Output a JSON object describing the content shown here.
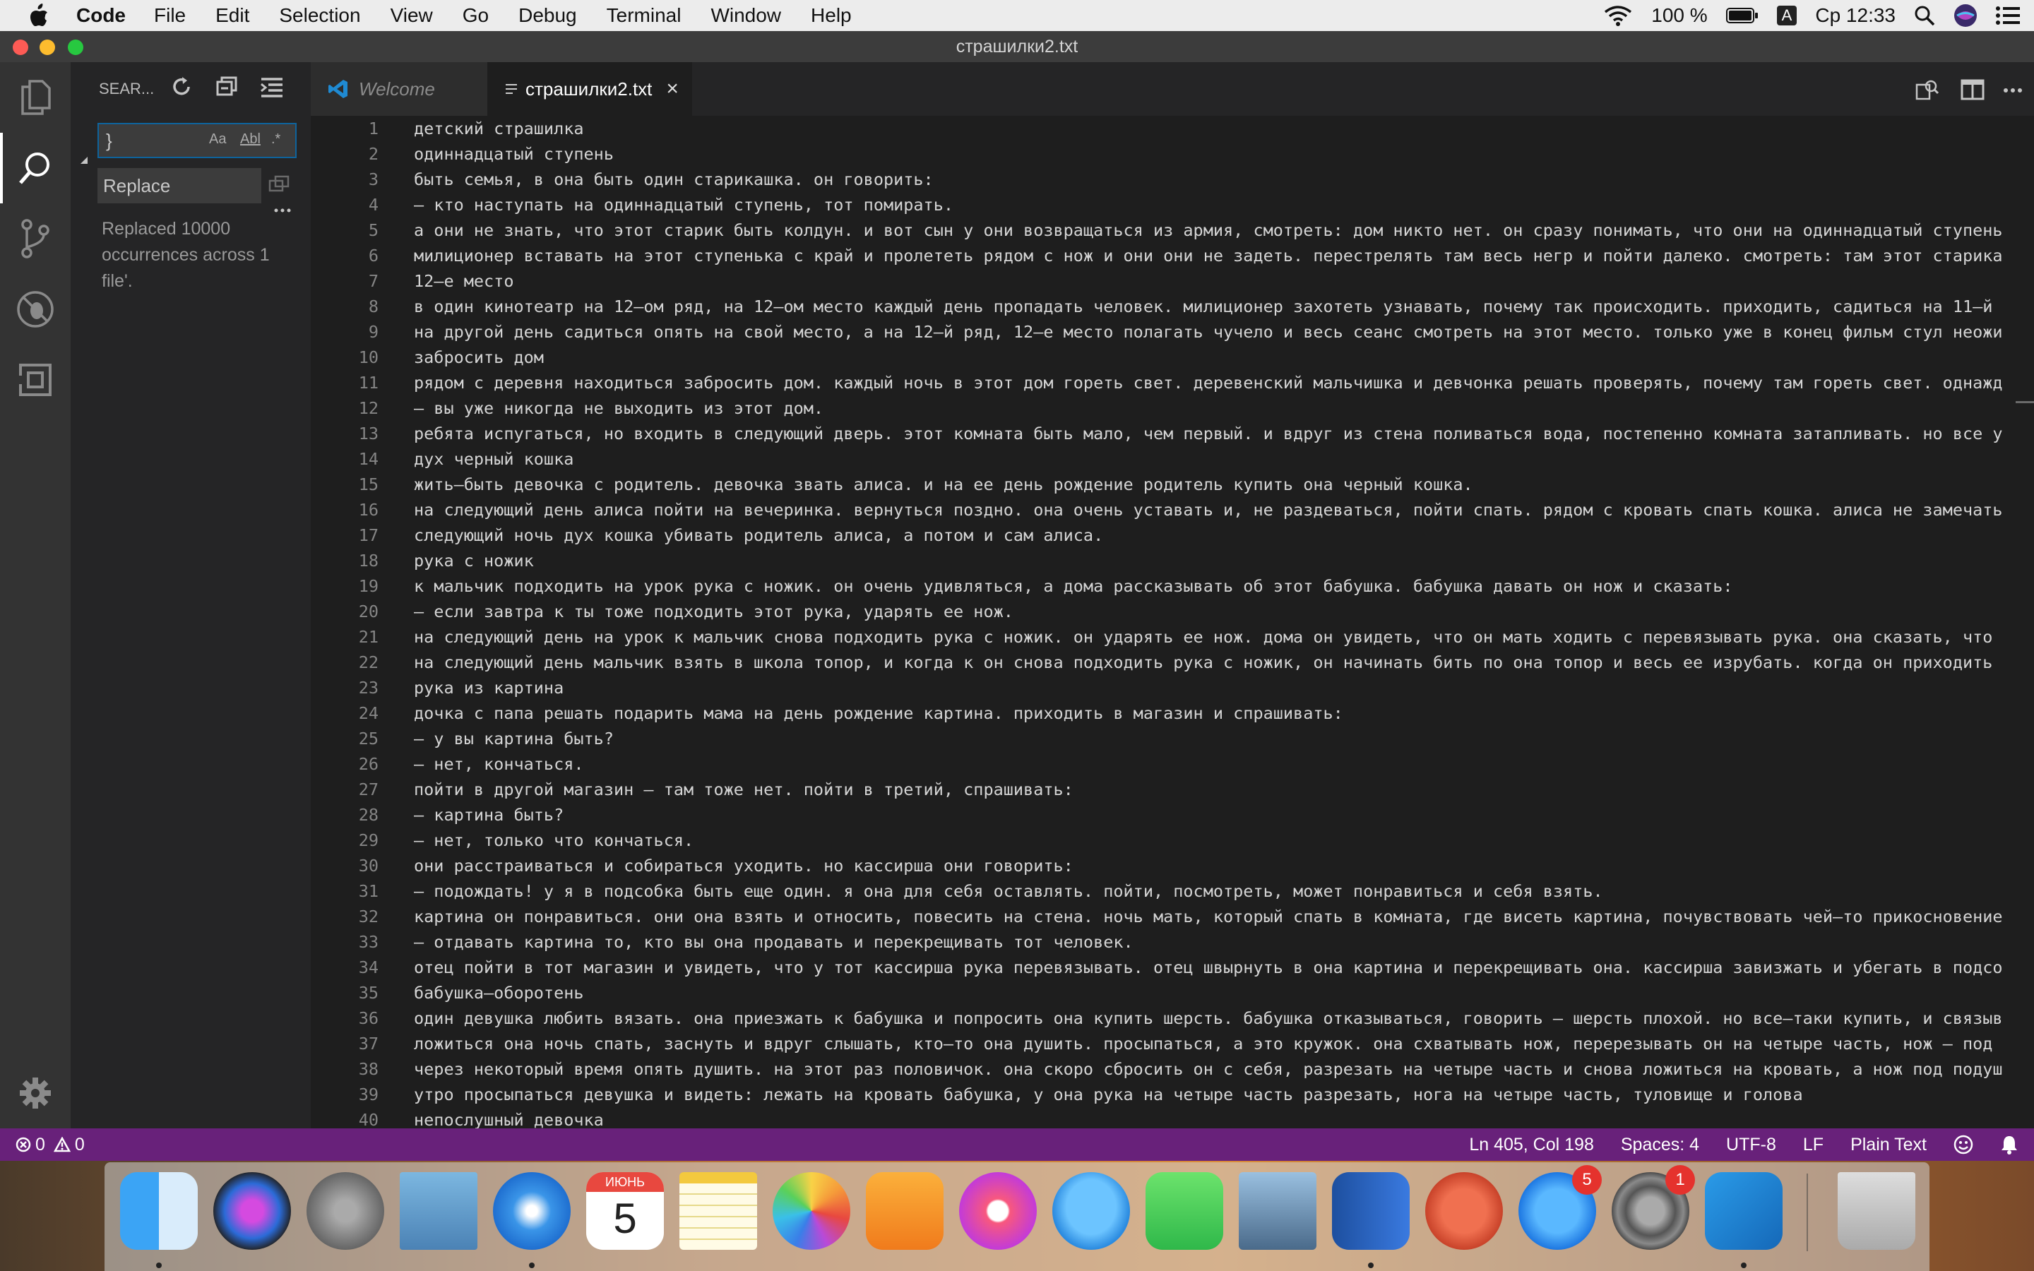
{
  "menubar": {
    "app": "Code",
    "items": [
      "File",
      "Edit",
      "Selection",
      "View",
      "Go",
      "Debug",
      "Terminal",
      "Window",
      "Help"
    ],
    "battery": "100 %",
    "input_source": "A",
    "clock": "Ср 12:33"
  },
  "window": {
    "title": "страшилки2.txt"
  },
  "sidebar": {
    "header": "SEAR...",
    "search_value": "}",
    "search_opts": [
      "Aa",
      "Abl",
      ".*"
    ],
    "replace_placeholder": "Replace",
    "result_message": "Replaced 10000 occurrences across 1 file'."
  },
  "tabs": [
    {
      "label": "Welcome",
      "active": false
    },
    {
      "label": "страшилки2.txt",
      "active": true,
      "close": "×"
    }
  ],
  "editor": {
    "lines": [
      "детский страшилка",
      "одиннадцатый ступень",
      "быть семья, в она быть один старикашка. он говорить:",
      "— кто наступать на одиннадцатый ступень, тот помирать.",
      "а они не знать, что этот старик быть колдун. и вот сын у они возвращаться из армия, смотреть: дом никто нет. он сразу понимать, что они на одиннадцатый ступень",
      "милиционер вставать на этот ступенька с край и пролететь рядом с нож и они они не задеть. перестрелять там весь негр и пойти далеко. смотреть: там этот старика",
      "12–е место",
      "в один кинотеатр на 12–ом ряд, на 12–ом место каждый день пропадать человек. милиционер захотеть узнавать, почему так происходить. приходить, садиться на 11–й",
      "на другой день садиться опять на свой место, а на 12–й ряд, 12–е место полагать чучело и весь сеанс смотреть на этот место. только уже в конец фильм стул неожи",
      "забросить дом",
      "рядом с деревня находиться забросить дом. каждый ночь в этот дом гореть свет. деревенский мальчишка и девчонка решать проверять, почему там гореть свет. однажд",
      "— вы уже никогда не выходить из этот дом.",
      "ребята испугаться, но входить в следующий дверь. этот комната быть мало, чем первый. и вдруг из стена поливаться вода, постепенно комната затапливать. но все у",
      "дух черный кошка",
      "жить–быть девочка с родитель. девочка звать алиса. и на ее день рождение родитель купить она черный кошка.",
      "на следующий день алиса пойти на вечеринка. вернуться поздно. она очень уставать и, не раздеваться, пойти спать. рядом с кровать спать кошка. алиса не замечать",
      "следующий ночь дух кошка убивать родитель алиса, а потом и сам алиса.",
      "рука с ножик",
      "к мальчик подходить на урок рука с ножик. он очень удивляться, а дома рассказывать об этот бабушка. бабушка давать он нож и сказать:",
      "— если завтра к ты тоже подходить этот рука, ударять ее нож.",
      "на следующий день на урок к мальчик снова подходить рука с ножик. он ударять ее нож. дома он увидеть, что он мать ходить с перевязывать рука. она сказать, что",
      "на следующий день мальчик взять в школа топор, и когда к он снова подходить рука с ножик, он начинать бить по она топор и весь ее изрубать. когда он приходить",
      "рука из картина",
      "дочка с папа решать подарить мама на день рождение картина. приходить в магазин и спрашивать:",
      "— у вы картина быть?",
      "— нет, кончаться.",
      "пойти в другой магазин — там тоже нет. пойти в третий, спрашивать:",
      "— картина быть?",
      "— нет, только что кончаться.",
      "они расстраиваться и собираться уходить. но кассирша они говорить:",
      "— подождать! у я в подсобка быть еще один. я она для себя оставлять. пойти, посмотреть, может понравиться и себя взять.",
      "картина он понравиться. они она взять и относить, повесить на стена. ночь мать, который спать в комната, где висеть картина, почувствовать чей–то прикосновение",
      "— отдавать картина то, кто вы она продавать и перекрещивать тот человек.",
      "отец пойти в тот магазин и увидеть, что у тот кассирша рука перевязывать. отец швырнуть в она картина и перекрещивать она. кассирша завизжать и убегать в подсо",
      "бабушка–оборотень",
      "один девушка любить вязать. она приезжать к бабушка и попросить она купить шерсть. бабушка отказываться, говорить — шерсть плохой. но все–таки купить, и связыв",
      "ложиться она ночь спать, заснуть и вдруг слышать, кто–то она душить. просыпаться, а это кружок. она схватывать нож, перерезывать он на четыре часть, нож — под",
      "через некоторый время опять душить. на этот раз половичок. она скоро сбросить он с себя, разрезать на четыре часть и снова ложиться на кровать, а нож под подуш",
      "утро просыпаться девушка и видеть: лежать на кровать бабушка, у она рука на четыре часть разрезать, нога на четыре часть, туловище и голова",
      "непослушный девочка"
    ]
  },
  "statusbar": {
    "errors": "0",
    "warnings": "0",
    "position": "Ln 405, Col 198",
    "spaces": "Spaces: 4",
    "encoding": "UTF-8",
    "eol": "LF",
    "language": "Plain Text"
  },
  "dock": {
    "calendar_month": "ИЮНЬ",
    "calendar_day": "5",
    "appstore_badge": "5",
    "settings_badge": "1"
  },
  "colors": {
    "statusbar": "#68217a",
    "editor_bg": "#1e1e1e",
    "sidebar_bg": "#252526",
    "accent": "#0e639c"
  }
}
